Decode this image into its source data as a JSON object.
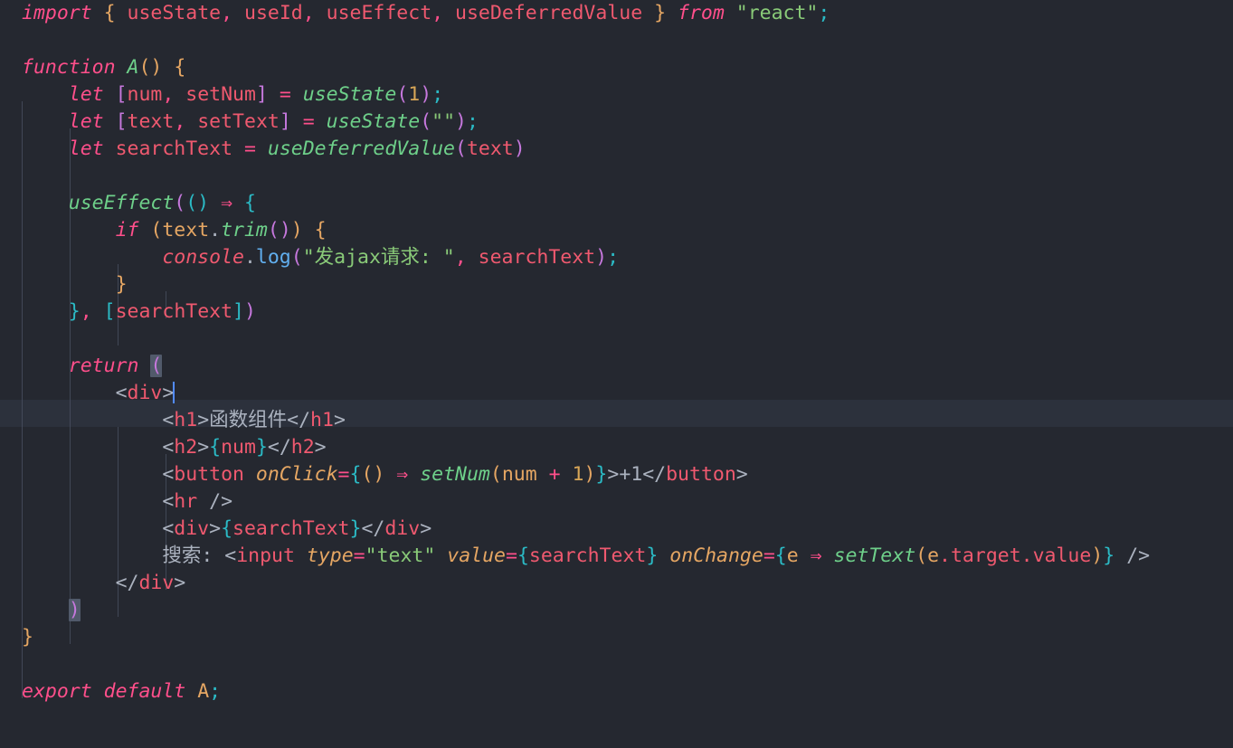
{
  "editor": {
    "language": "jsx",
    "theme": "one-dark-pro",
    "background": "#252830",
    "active_line_color": "#2c313c",
    "cursor_color": "#528bff",
    "cursor_line": 17,
    "cursor_column": 14,
    "font_size_px": 21.5,
    "line_height_px": 30,
    "bracket_match_color": "#515a6b"
  },
  "palette": {
    "keyword": "#ff4f8b",
    "function": "#6ed08a",
    "identifier": "#ef596f",
    "string": "#89ca78",
    "number": "#d8a657",
    "parameter": "#e5a663",
    "jsx_brace": "#2bbac5",
    "paren": "#c678dd",
    "method": "#61afef",
    "plain": "#abb2bf"
  },
  "code": {
    "lines": [
      "import { useState, useId, useEffect, useDeferredValue } from \"react\";",
      "",
      "function A() {",
      "    let [num, setNum] = useState(1);",
      "    let [text, setText] = useState(\"\");",
      "    let searchText = useDeferredValue(text)",
      "",
      "    useEffect(() => {",
      "        if (text.trim()) {",
      "            console.log(\"发ajax请求: \", searchText);",
      "        }",
      "    }, [searchText])",
      "",
      "    return (",
      "        <div>",
      "            <h1>函数组件</h1>",
      "            <h2>{num}</h2>",
      "            <button onClick={() => setNum(num + 1)}>+1</button>",
      "            <hr />",
      "            <div>{searchText}</div>",
      "            搜索: <input type=\"text\" value={searchText} onChange={e => setText(e.target.value)} />",
      "        </div>",
      "    )",
      "}",
      "",
      "export default A;"
    ]
  },
  "tokens": {
    "l1": {
      "import": "import",
      "brace_open": "{",
      "useState": "useState",
      "comma1": ",",
      "useId": "useId",
      "comma2": ",",
      "useEffect": "useEffect",
      "comma3": ",",
      "useDeferredValue": "useDeferredValue",
      "brace_close": "}",
      "from": "from",
      "module": "\"react\"",
      "semi": ";"
    },
    "l3": {
      "function": "function",
      "name": "A",
      "parens": "()",
      "brace": "{"
    },
    "l4": {
      "let": "let",
      "bracket_open": "[",
      "num": "num",
      "comma": ",",
      "setNum": "setNum",
      "bracket_close": "]",
      "eq": "=",
      "useState": "useState",
      "lp": "(",
      "one": "1",
      "rp": ")",
      "semi": ";"
    },
    "l5": {
      "let": "let",
      "bracket_open": "[",
      "text": "text",
      "comma": ",",
      "setText": "setText",
      "bracket_close": "]",
      "eq": "=",
      "useState": "useState",
      "lp": "(",
      "empty": "\"\"",
      "rp": ")",
      "semi": ";"
    },
    "l6": {
      "let": "let",
      "searchText": "searchText",
      "eq": "=",
      "useDeferredValue": "useDeferredValue",
      "lp": "(",
      "text": "text",
      "rp": ")"
    },
    "l8": {
      "useEffect": "useEffect",
      "lp": "(",
      "arrowparens": "()",
      "arrow": "⇒",
      "brace": "{",
      "rp2": ""
    },
    "l9": {
      "if": "if",
      "lp": "(",
      "text": "text",
      "dot": ".",
      "trim": "trim",
      "callparens": "()",
      "rp": ")",
      "brace": "{"
    },
    "l10": {
      "console": "console",
      "dot": ".",
      "log": "log",
      "lp": "(",
      "str": "\"发ajax请求: \"",
      "comma": ",",
      "searchText": "searchText",
      "rp": ")",
      "semi": ";"
    },
    "l11": {
      "brace": "}"
    },
    "l12": {
      "brace": "}",
      "comma": ",",
      "bracket_open": "[",
      "searchText": "searchText",
      "bracket_close": "]",
      "rp": ")"
    },
    "l14": {
      "return": "return",
      "paren": "("
    },
    "l15": {
      "lt": "<",
      "tag": "div",
      "gt": ">"
    },
    "l16": {
      "lt": "<",
      "tag": "h1",
      "gt": ">",
      "text": "函数组件",
      "lt_close": "</",
      "tag_close": "h1",
      "gt_close": ">"
    },
    "l17": {
      "lt": "<",
      "tag": "h2",
      "gt": ">",
      "brace_open": "{",
      "num": "num",
      "brace_close": "}",
      "lt_close": "</",
      "tag_close": "h2",
      "gt_close": ">"
    },
    "l18": {
      "lt": "<",
      "tag": "button",
      "attr": "onClick",
      "eq": "=",
      "brace_open": "{",
      "arrowparens": "()",
      "arrow": "⇒",
      "setNum": "setNum",
      "lp": "(",
      "num": "num",
      "plus": "+",
      "one": "1",
      "rp": ")",
      "brace_close": "}",
      "gt": ">",
      "label": "+1",
      "lt_close": "</",
      "tag_close": "button",
      "gt_close": ">"
    },
    "l19": {
      "lt": "<",
      "tag": "hr",
      "selfclose": "/>"
    },
    "l20": {
      "lt": "<",
      "tag": "div",
      "gt": ">",
      "brace_open": "{",
      "searchText": "searchText",
      "brace_close": "}",
      "lt_close": "</",
      "tag_close": "div",
      "gt_close": ">"
    },
    "l21": {
      "label": "搜索:",
      "lt": "<",
      "tag": "input",
      "attr_type": "type",
      "eq1": "=",
      "val_type": "\"text\"",
      "attr_value": "value",
      "eq2": "=",
      "brace_open": "{",
      "searchText": "searchText",
      "brace_close": "}",
      "attr_change": "onChange",
      "eq3": "=",
      "brace_open2": "{",
      "param_e": "e",
      "arrow": "⇒",
      "setText": "setText",
      "lp": "(",
      "e": "e",
      "dot_target": ".target",
      "dot_value": ".value",
      "rp": ")",
      "brace_close2": "}",
      "selfclose": "/>"
    },
    "l22": {
      "lt_close": "</",
      "tag_close": "div",
      "gt_close": ">"
    },
    "l23": {
      "paren": ")"
    },
    "l24": {
      "brace": "}"
    },
    "l26": {
      "export": "export",
      "default": "default",
      "name": "A",
      "semi": ";"
    }
  }
}
